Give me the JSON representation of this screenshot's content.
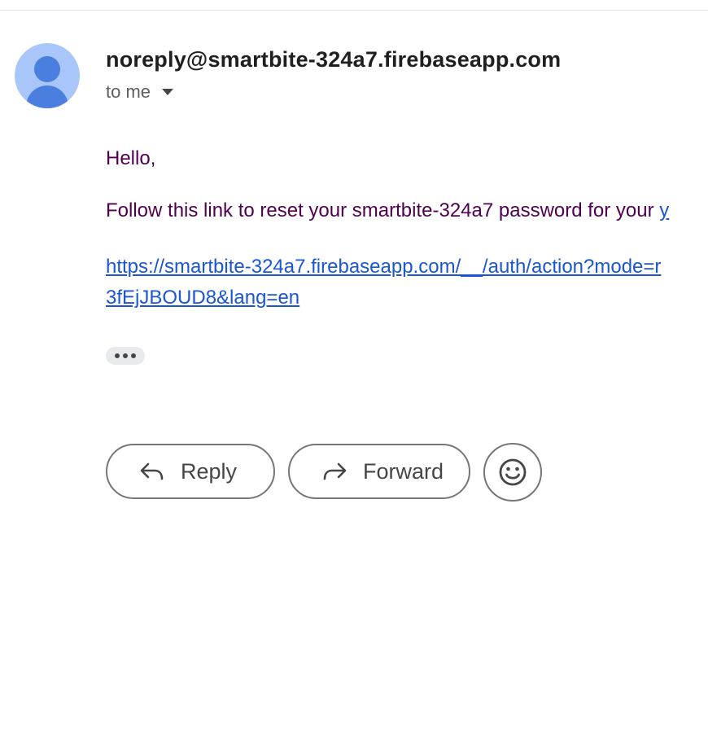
{
  "message": {
    "sender_email": "noreply@smartbite-324a7.firebaseapp.com",
    "recipient_label": "to me",
    "greeting": "Hello,",
    "instruction": "Follow this link to reset your smartbite-324a7 password for your ",
    "instruction_cut": "y",
    "reset_link_line1": "https://smartbite-324a7.firebaseapp.com/__/auth/action?mode=r",
    "reset_link_line2": "3fEjJBOUD8&lang=en"
  },
  "actions": {
    "reply_label": "Reply",
    "forward_label": "Forward"
  },
  "icons": {
    "avatar": "default-person-avatar",
    "recipient_details": "caret-down-icon",
    "show_trimmed": "more-horizontal-icon",
    "reply": "reply-arrow-icon",
    "forward": "forward-arrow-icon",
    "emoji": "emoji-reaction-icon"
  },
  "colors": {
    "avatar_background": "#a8c6fa",
    "avatar_figure": "#4a7fe0",
    "body_text": "#500050",
    "link": "#1a55d4",
    "button_border": "#747775"
  }
}
